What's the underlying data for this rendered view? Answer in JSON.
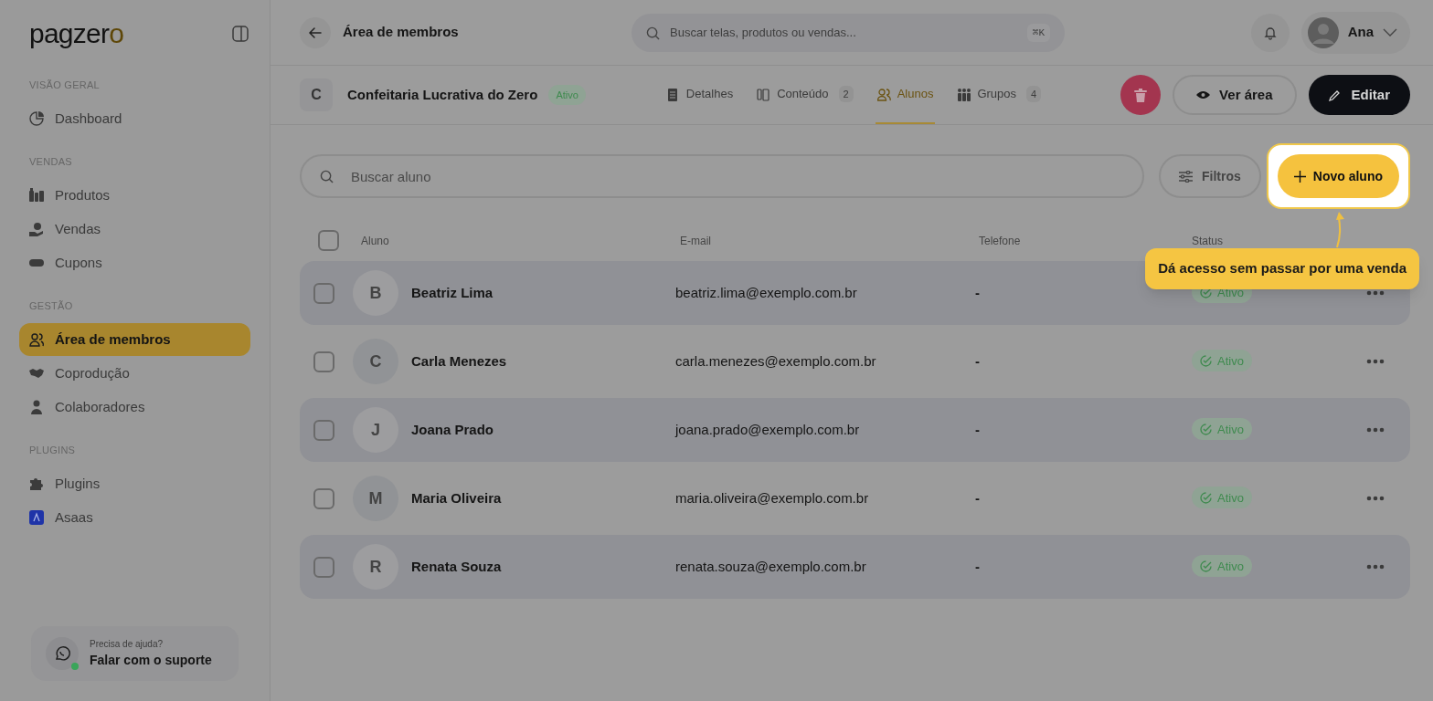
{
  "brand": {
    "name": "pagzero"
  },
  "sidebar": {
    "sections": [
      {
        "heading": "VISÃO GERAL",
        "items": [
          {
            "label": "Dashboard",
            "selected": false
          }
        ]
      },
      {
        "heading": "VENDAS",
        "items": [
          {
            "label": "Produtos",
            "selected": false
          },
          {
            "label": "Vendas",
            "selected": false
          },
          {
            "label": "Cupons",
            "selected": false
          }
        ]
      },
      {
        "heading": "GESTÃO",
        "items": [
          {
            "label": "Área de membros",
            "selected": true
          },
          {
            "label": "Coprodução",
            "selected": false
          },
          {
            "label": "Colaboradores",
            "selected": false
          }
        ]
      },
      {
        "heading": "PLUGINS",
        "items": [
          {
            "label": "Plugins",
            "selected": false
          },
          {
            "label": "Asaas",
            "selected": false
          }
        ]
      }
    ],
    "support": {
      "caption": "Precisa de ajuda?",
      "label": "Falar com o suporte",
      "online": true
    }
  },
  "header": {
    "title": "Área de membros",
    "search": {
      "placeholder": "Buscar telas, produtos ou vendas...",
      "shortcut": "⌘K"
    },
    "user": {
      "name": "Ana"
    }
  },
  "product": {
    "initial": "C",
    "name": "Confeitaria Lucrativa do Zero",
    "status": "Ativo"
  },
  "tabs": [
    {
      "label": "Detalhes",
      "selected": false
    },
    {
      "label": "Conteúdo",
      "count": "2",
      "selected": false
    },
    {
      "label": "Alunos",
      "selected": true
    },
    {
      "label": "Grupos",
      "count": "4",
      "selected": false
    }
  ],
  "actions": {
    "view": "Ver área",
    "edit": "Editar"
  },
  "toolbar": {
    "search": {
      "placeholder": "Buscar aluno"
    },
    "filter": "Filtros",
    "new": "Novo aluno"
  },
  "tour_tip": {
    "text": "Dá acesso sem passar por uma venda"
  },
  "table": {
    "select_all_checked": false,
    "columns": [
      "Aluno",
      "E-mail",
      "Telefone",
      "Status"
    ],
    "rows": [
      {
        "initial": "B",
        "name": "Beatriz Lima",
        "email": "beatriz.lima@exemplo.com.br",
        "phone": "-",
        "status": "Ativo",
        "checked": false
      },
      {
        "initial": "C",
        "name": "Carla Menezes",
        "email": "carla.menezes@exemplo.com.br",
        "phone": "-",
        "status": "Ativo",
        "checked": false
      },
      {
        "initial": "J",
        "name": "Joana Prado",
        "email": "joana.prado@exemplo.com.br",
        "phone": "-",
        "status": "Ativo",
        "checked": false
      },
      {
        "initial": "M",
        "name": "Maria Oliveira",
        "email": "maria.oliveira@exemplo.com.br",
        "phone": "-",
        "status": "Ativo",
        "checked": false
      },
      {
        "initial": "R",
        "name": "Renata Souza",
        "email": "renata.souza@exemplo.com.br",
        "phone": "-",
        "status": "Ativo",
        "checked": false
      }
    ]
  }
}
